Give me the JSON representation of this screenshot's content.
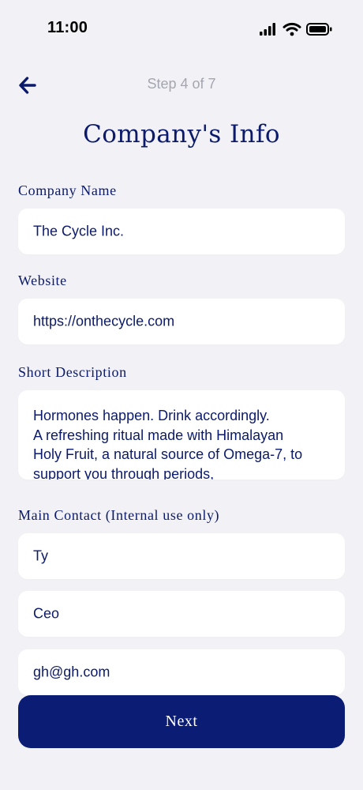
{
  "status_bar": {
    "time": "11:00",
    "icons": [
      "signal-icon",
      "wifi-icon",
      "battery-icon"
    ]
  },
  "header": {
    "back_icon": "arrow-left-icon",
    "step": "Step 4 of 7",
    "title": "Company's Info"
  },
  "form": {
    "company_name": {
      "label": "Company Name",
      "value": "The Cycle Inc."
    },
    "website": {
      "label": "Website",
      "value": "https://onthecycle.com"
    },
    "short_description": {
      "label": "Short Description",
      "value": "Hormones happen. Drink accordingly.\nA refreshing ritual made with Himalayan\nHoly Fruit, a natural source of Omega-7, to\nsupport you through periods,"
    },
    "main_contact": {
      "label": "Main Contact (Internal use only)",
      "name": "Ty",
      "title": "Ceo",
      "email": "gh@gh.com"
    }
  },
  "actions": {
    "next_label": "Next"
  },
  "colors": {
    "background": "#F2F2F6",
    "primary": "#0A1C74",
    "text": "#0B1A6B",
    "muted": "#A5A5B0",
    "field": "#FFFFFF"
  }
}
